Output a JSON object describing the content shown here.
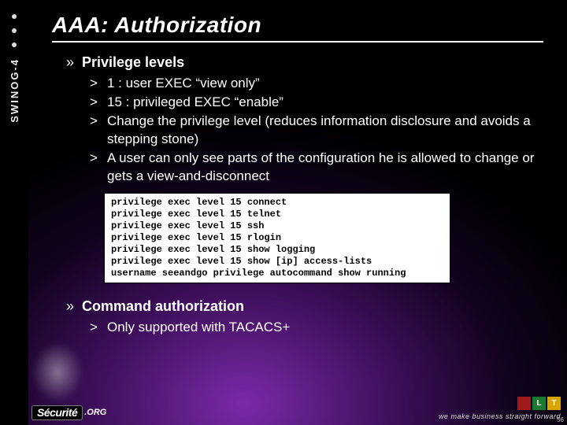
{
  "sidebar": {
    "label": "SWINOG-4"
  },
  "title": "AAA: Authorization",
  "sections": [
    {
      "heading": "Privilege levels",
      "items": [
        "1   : user EXEC “view only”",
        "15 : privileged EXEC “enable”",
        "Change the privilege level (reduces information disclosure and avoids a stepping stone)",
        "A user can only see parts of the configuration he is allowed to change or gets a view-and-disconnect"
      ],
      "code": "privilege exec level 15 connect\nprivilege exec level 15 telnet\nprivilege exec level 15 ssh\nprivilege exec level 15 rlogin\nprivilege exec level 15 show logging\nprivilege exec level 15 show [ip] access-lists\nusername seeandgo privilege autocommand show running"
    },
    {
      "heading": "Command authorization",
      "items": [
        "Only supported with TACACS+"
      ]
    }
  ],
  "footer": {
    "brand": "Sécurité",
    "brand_suffix": ".ORG",
    "tagline": "we make business straight forward",
    "blocks": [
      {
        "label": "",
        "color": "#a01818"
      },
      {
        "label": "L",
        "color": "#1a7a2f"
      },
      {
        "label": "T",
        "color": "#d9a400"
      }
    ],
    "page": "56"
  }
}
